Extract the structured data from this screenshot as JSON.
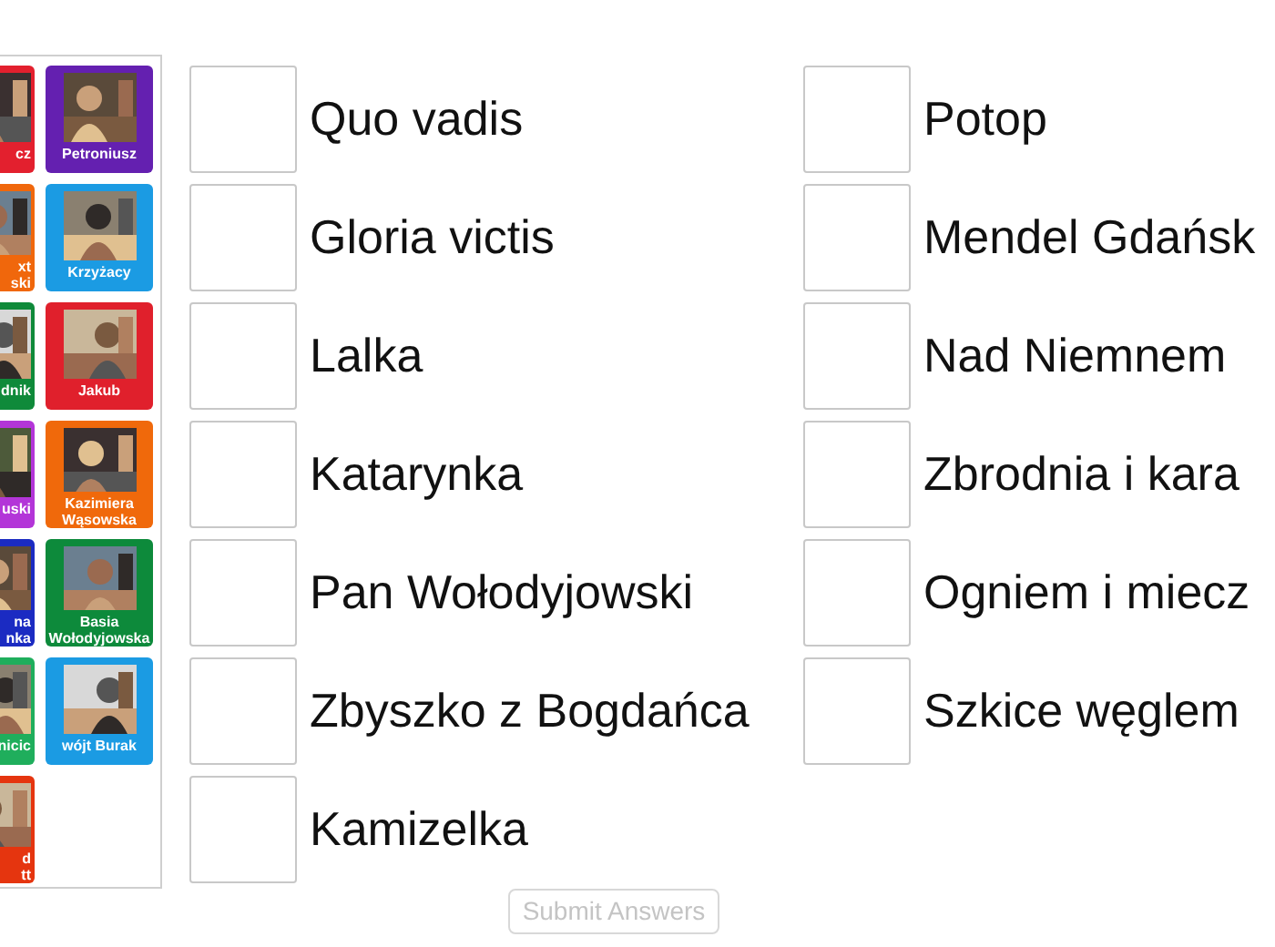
{
  "tiles_left_column": [
    {
      "label": "cz",
      "color": "#e3202e"
    },
    {
      "label": "xt\nski",
      "color": "#f0670c"
    },
    {
      "label": "dnik",
      "color": "#0f8a3a"
    },
    {
      "label": "uski",
      "color": "#b335d8"
    },
    {
      "label": "na\nnka",
      "color": "#1b2bc2"
    },
    {
      "label": "nicic",
      "color": "#1fae5c"
    },
    {
      "label": "d\ntt",
      "color": "#e5350f"
    }
  ],
  "tiles_right_column": [
    {
      "label": "Petroniusz",
      "color": "#6420b0"
    },
    {
      "label": "Krzyżacy",
      "color": "#1b9be3"
    },
    {
      "label": "Jakub",
      "color": "#e0202c"
    },
    {
      "label": "Kazimiera\nWąsowska",
      "color": "#f0690b"
    },
    {
      "label": "Basia\nWołodyjowska",
      "color": "#0d8a3b"
    },
    {
      "label": "wójt Burak",
      "color": "#1b9be3"
    }
  ],
  "answers_column_1": [
    "Quo vadis",
    "Gloria victis",
    "Lalka",
    "Katarynka",
    "Pan Wołodyjowski",
    "Zbyszko z Bogdańca",
    "Kamizelka"
  ],
  "answers_column_2": [
    "Potop",
    "Mendel Gdańsk",
    "Nad Niemnem",
    "Zbrodnia i kara",
    "Ogniem i miecz",
    "Szkice węglem"
  ],
  "submit_button": {
    "label": "Submit Answers",
    "disabled": true
  }
}
